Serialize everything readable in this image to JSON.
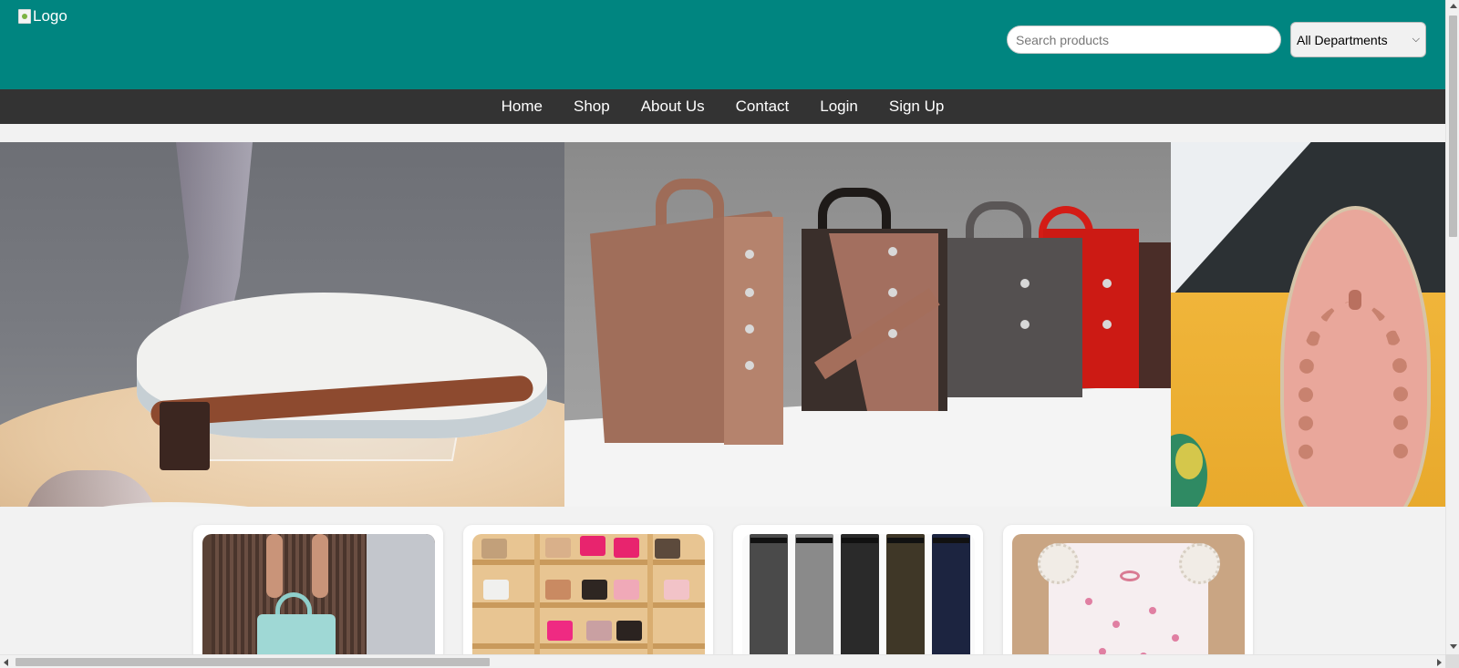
{
  "header": {
    "logo_alt": "Logo",
    "search_placeholder": "Search products",
    "department_selected": "All Departments",
    "background_color": "#008580"
  },
  "nav": {
    "items": [
      {
        "label": "Home"
      },
      {
        "label": "Shop"
      },
      {
        "label": "About Us"
      },
      {
        "label": "Contact"
      },
      {
        "label": "Login"
      },
      {
        "label": "Sign Up"
      }
    ],
    "background_color": "#333333"
  },
  "hero": {
    "slides": [
      {
        "subject": "white leather sandals on display stand"
      },
      {
        "subject": "row of leather handbags on shelf"
      },
      {
        "subject": "pink flip-flop sandal with chain strap"
      }
    ]
  },
  "products": [
    {
      "image": "teal handbag held in front of plaid dress"
    },
    {
      "image": "shelves of assorted handbags"
    },
    {
      "image": "row of men's dress trousers"
    },
    {
      "image": "floral ruffle-sleeve top"
    }
  ],
  "icons": {
    "broken_image": "broken-image-icon",
    "dropdown": "chevron-down-icon"
  }
}
